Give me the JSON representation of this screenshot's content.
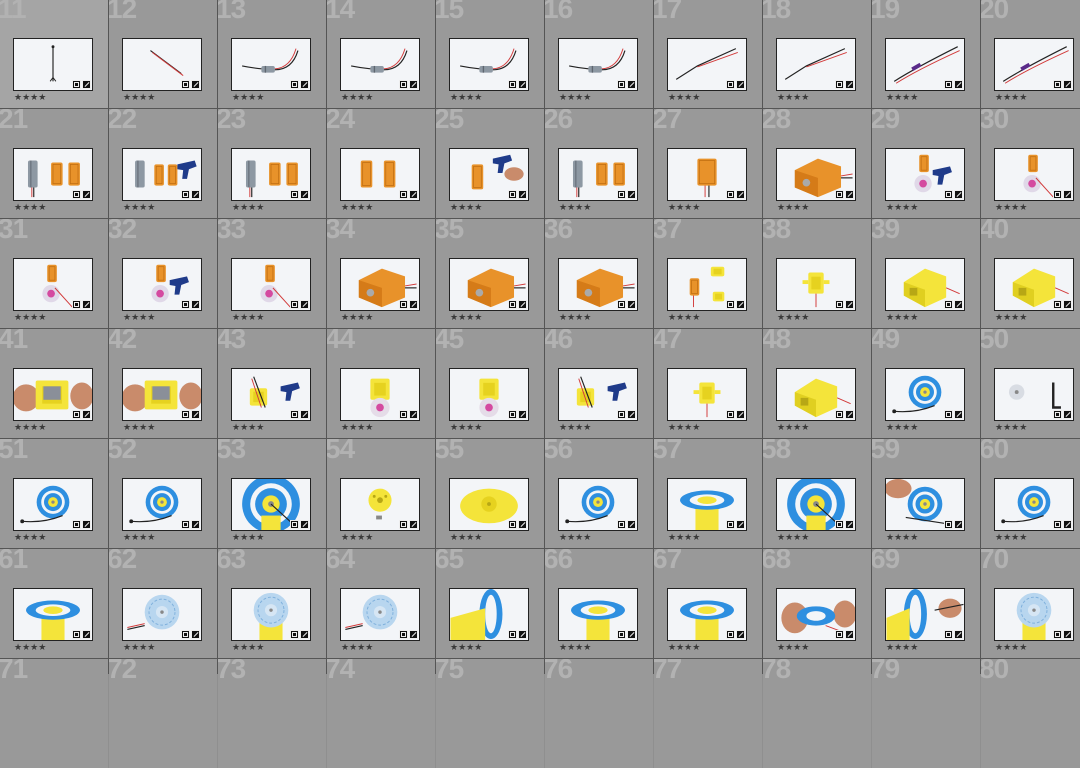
{
  "grid": {
    "rows": [
      {
        "row_index": 0,
        "cells": [
          {
            "number": "11",
            "rating": "★★★★",
            "scene": "wire"
          },
          {
            "number": "12",
            "rating": "★★★★",
            "scene": "wire2"
          },
          {
            "number": "13",
            "rating": "★★★★",
            "scene": "motor-wire"
          },
          {
            "number": "14",
            "rating": "★★★★",
            "scene": "motor-wire"
          },
          {
            "number": "15",
            "rating": "★★★★",
            "scene": "motor-wire"
          },
          {
            "number": "16",
            "rating": "★★★★",
            "scene": "motor-wire"
          },
          {
            "number": "17",
            "rating": "★★★★",
            "scene": "wires"
          },
          {
            "number": "18",
            "rating": "★★★★",
            "scene": "wires"
          },
          {
            "number": "19",
            "rating": "★★★★",
            "scene": "wires-heat"
          },
          {
            "number": "20",
            "rating": "★★★★",
            "scene": "wires-heat"
          }
        ]
      },
      {
        "row_index": 1,
        "cells": [
          {
            "number": "21",
            "rating": "★★★★",
            "scene": "motor-cases"
          },
          {
            "number": "22",
            "rating": "★★★★",
            "scene": "motor-cases-gun"
          },
          {
            "number": "23",
            "rating": "★★★★",
            "scene": "motor-cases"
          },
          {
            "number": "24",
            "rating": "★★★★",
            "scene": "cases"
          },
          {
            "number": "25",
            "rating": "★★★★",
            "scene": "cases-gun"
          },
          {
            "number": "26",
            "rating": "★★★★",
            "scene": "motor-cases"
          },
          {
            "number": "27",
            "rating": "★★★★",
            "scene": "box-small"
          },
          {
            "number": "28",
            "rating": "★★★★",
            "scene": "box-big"
          },
          {
            "number": "29",
            "rating": "★★★★",
            "scene": "box-disc-gun"
          },
          {
            "number": "30",
            "rating": "★★★★",
            "scene": "box-disc"
          }
        ]
      },
      {
        "row_index": 2,
        "cells": [
          {
            "number": "31",
            "rating": "★★★★",
            "scene": "box-disc"
          },
          {
            "number": "32",
            "rating": "★★★★",
            "scene": "box-disc-gun"
          },
          {
            "number": "33",
            "rating": "★★★★",
            "scene": "box-disc"
          },
          {
            "number": "34",
            "rating": "★★★★",
            "scene": "box-big"
          },
          {
            "number": "35",
            "rating": "★★★★",
            "scene": "box-big"
          },
          {
            "number": "36",
            "rating": "★★★★",
            "scene": "box-big"
          },
          {
            "number": "37",
            "rating": "★★★★",
            "scene": "box-parts"
          },
          {
            "number": "38",
            "rating": "★★★★",
            "scene": "yellow-small"
          },
          {
            "number": "39",
            "rating": "★★★★",
            "scene": "yellow-big"
          },
          {
            "number": "40",
            "rating": "★★★★",
            "scene": "yellow-big"
          }
        ]
      },
      {
        "row_index": 3,
        "cells": [
          {
            "number": "41",
            "rating": "★★★★",
            "scene": "hands-yellow"
          },
          {
            "number": "42",
            "rating": "★★★★",
            "scene": "hands-yellow"
          },
          {
            "number": "43",
            "rating": "★★★★",
            "scene": "yellow-gun"
          },
          {
            "number": "44",
            "rating": "★★★★",
            "scene": "yellow-disc"
          },
          {
            "number": "45",
            "rating": "★★★★",
            "scene": "yellow-disc"
          },
          {
            "number": "46",
            "rating": "★★★★",
            "scene": "yellow-gun"
          },
          {
            "number": "47",
            "rating": "★★★★",
            "scene": "yellow-small"
          },
          {
            "number": "48",
            "rating": "★★★★",
            "scene": "yellow-big"
          },
          {
            "number": "49",
            "rating": "★★★★",
            "scene": "blue-disc-wire"
          },
          {
            "number": "50",
            "rating": "★★★★",
            "scene": "hexkey"
          }
        ]
      },
      {
        "row_index": 4,
        "cells": [
          {
            "number": "51",
            "rating": "★★★★",
            "scene": "blue-disc-wire"
          },
          {
            "number": "52",
            "rating": "★★★★",
            "scene": "blue-disc-wire"
          },
          {
            "number": "53",
            "rating": "★★★★",
            "scene": "blue-disc-big"
          },
          {
            "number": "54",
            "rating": "★★★★",
            "scene": "yellow-hub"
          },
          {
            "number": "55",
            "rating": "★★★★",
            "scene": "yellow-hub-big"
          },
          {
            "number": "56",
            "rating": "★★★★",
            "scene": "blue-disc-wire"
          },
          {
            "number": "57",
            "rating": "★★★★",
            "scene": "blue-stack"
          },
          {
            "number": "58",
            "rating": "★★★★",
            "scene": "blue-disc-big"
          },
          {
            "number": "59",
            "rating": "★★★★",
            "scene": "blue-disc-hands"
          },
          {
            "number": "60",
            "rating": "★★★★",
            "scene": "blue-disc-wire"
          }
        ]
      },
      {
        "row_index": 5,
        "cells": [
          {
            "number": "61",
            "rating": "★★★★",
            "scene": "blue-stack"
          },
          {
            "number": "62",
            "rating": "★★★★",
            "scene": "pale-disc"
          },
          {
            "number": "63",
            "rating": "★★★★",
            "scene": "pale-disc-yellow"
          },
          {
            "number": "64",
            "rating": "★★★★",
            "scene": "pale-disc"
          },
          {
            "number": "65",
            "rating": "★★★★",
            "scene": "side-disc"
          },
          {
            "number": "66",
            "rating": "★★★★",
            "scene": "blue-stack"
          },
          {
            "number": "67",
            "rating": "★★★★",
            "scene": "blue-stack"
          },
          {
            "number": "68",
            "rating": "★★★★",
            "scene": "hands-disc"
          },
          {
            "number": "69",
            "rating": "★★★★",
            "scene": "side-disc-hand"
          },
          {
            "number": "70",
            "rating": "★★★★",
            "scene": "pale-disc-yellow"
          }
        ]
      },
      {
        "row_index": 6,
        "cells": [
          {
            "number": "71",
            "rating": "",
            "scene": "empty"
          },
          {
            "number": "72",
            "rating": "",
            "scene": "empty"
          },
          {
            "number": "73",
            "rating": "",
            "scene": "empty"
          },
          {
            "number": "74",
            "rating": "",
            "scene": "empty"
          },
          {
            "number": "75",
            "rating": "",
            "scene": "empty"
          },
          {
            "number": "76",
            "rating": "",
            "scene": "empty"
          },
          {
            "number": "77",
            "rating": "",
            "scene": "empty"
          },
          {
            "number": "78",
            "rating": "",
            "scene": "empty"
          },
          {
            "number": "79",
            "rating": "",
            "scene": "empty"
          },
          {
            "number": "80",
            "rating": "",
            "scene": "empty"
          }
        ]
      }
    ]
  },
  "colors": {
    "orange": "#e8922a",
    "yellow": "#f4e43a",
    "blue": "#2e8fe0",
    "pale": "#b8d6ef",
    "wire_red": "#d23a3a",
    "wire_black": "#222222",
    "gun": "#1f3b8a",
    "skin": "#c98b6b"
  }
}
